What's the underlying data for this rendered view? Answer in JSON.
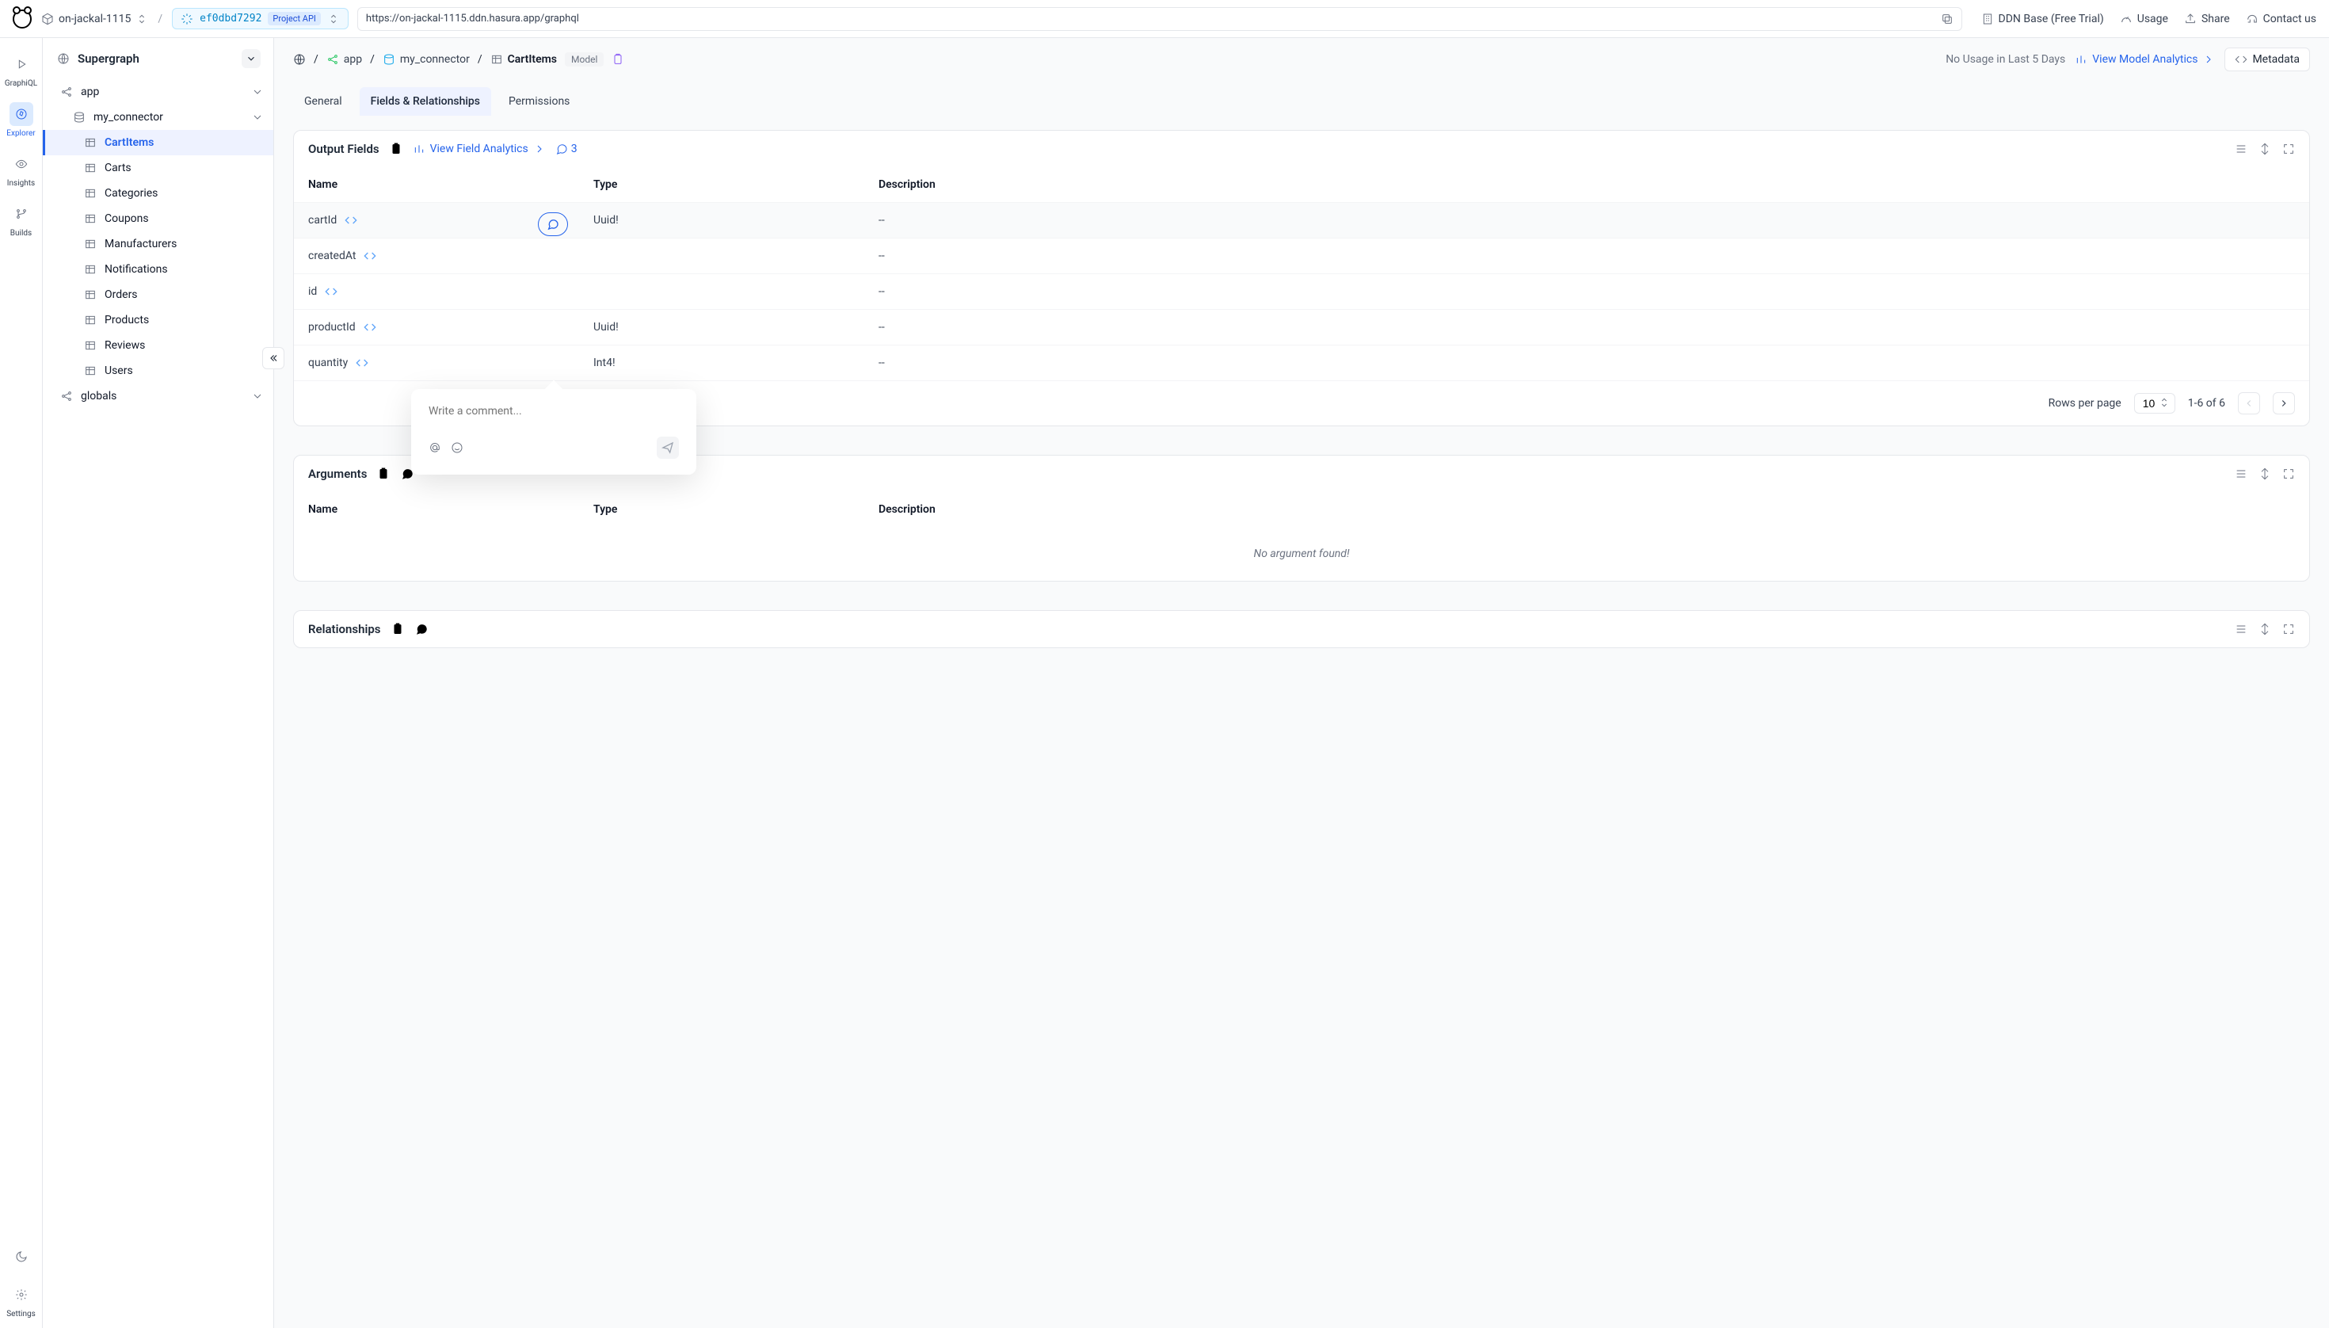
{
  "topbar": {
    "project": "on-jackal-1115",
    "hash": "ef0dbd7292",
    "api_label": "Project API",
    "url": "https://on-jackal-1115.ddn.hasura.app/graphql",
    "plan": "DDN Base (Free Trial)",
    "usage": "Usage",
    "share": "Share",
    "contact": "Contact us"
  },
  "rail": {
    "graphiql": "GraphiQL",
    "explorer": "Explorer",
    "insights": "Insights",
    "builds": "Builds",
    "settings": "Settings"
  },
  "sidebar": {
    "supergraph": "Supergraph",
    "app": "app",
    "connector": "my_connector",
    "items": [
      "CartItems",
      "Carts",
      "Categories",
      "Coupons",
      "Manufacturers",
      "Notifications",
      "Orders",
      "Products",
      "Reviews",
      "Users"
    ],
    "globals": "globals"
  },
  "breadcrumb": {
    "app": "app",
    "connector": "my_connector",
    "model": "CartItems",
    "badge": "Model",
    "usage": "No Usage in Last 5 Days",
    "analytics": "View Model Analytics",
    "metadata": "Metadata"
  },
  "tabs": {
    "general": "General",
    "fields": "Fields & Relationships",
    "permissions": "Permissions"
  },
  "output": {
    "title": "Output Fields",
    "view_analytics": "View Field Analytics",
    "comment_count": "3",
    "columns": {
      "name": "Name",
      "type": "Type",
      "desc": "Description"
    },
    "rows": [
      {
        "name": "cartId",
        "type": "Uuid!",
        "desc": "--"
      },
      {
        "name": "createdAt",
        "type": "",
        "desc": "--"
      },
      {
        "name": "id",
        "type": "",
        "desc": "--"
      },
      {
        "name": "productId",
        "type": "Uuid!",
        "desc": "--"
      },
      {
        "name": "quantity",
        "type": "Int4!",
        "desc": "--"
      }
    ],
    "pager": {
      "label": "Rows per page",
      "per": "10",
      "range": "1-6 of 6"
    }
  },
  "popup": {
    "placeholder": "Write a comment..."
  },
  "arguments": {
    "title": "Arguments",
    "columns": {
      "name": "Name",
      "type": "Type",
      "desc": "Description"
    },
    "empty": "No argument found!"
  },
  "relationships": {
    "title": "Relationships"
  }
}
